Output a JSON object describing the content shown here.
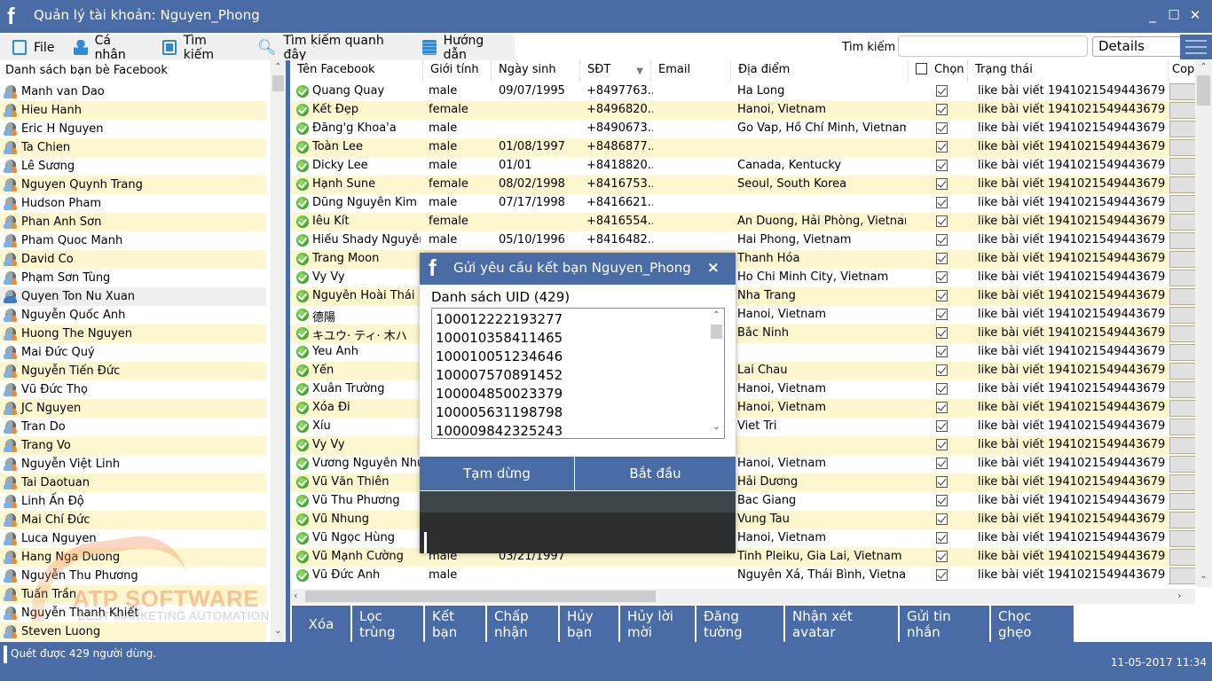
{
  "window": {
    "title": "Quản lý tài khoản: Nguyen_Phong",
    "logo": "f",
    "controls": {
      "minimize": "_",
      "maximize": "☐",
      "close": "✕"
    }
  },
  "menu": {
    "items": [
      {
        "label": "File",
        "icon": "file-icon"
      },
      {
        "label": "Cá nhân",
        "icon": "person-icon"
      },
      {
        "label": "Tìm kiếm",
        "icon": "id-card-icon"
      },
      {
        "label": "Tìm kiếm quanh đây",
        "icon": "search-icon"
      },
      {
        "label": "Hướng dẫn",
        "icon": "book-icon"
      }
    ],
    "search_label": "Tìm kiếm",
    "search_value": "",
    "view_selected": "Details"
  },
  "friends": {
    "header": "Danh sách bạn bè Facebook",
    "selected_index": 11,
    "items": [
      "Manh van Dao",
      "Hieu Hanh",
      "Eric H Nguyen",
      "Ta Chien",
      "Lê Sương",
      "Nguyen Quynh Trang",
      "Hudson Pham",
      "Phan Anh Sơn",
      "Pham Quoc Manh",
      "David Co",
      "Phạm Sơn Tùng",
      "Quyen Ton Nu Xuan",
      "Nguyễn Quốc Anh",
      "Huong The Nguyen",
      "Mai Đức Quý",
      "Nguyễn Tiến Đức",
      "Vũ Đức Thọ",
      "JC Nguyen",
      "Tran Do",
      "Trang Vo",
      "Nguyễn Việt Linh",
      "Tai Daotuan",
      "Linh Ấn Độ",
      "Mai Chí Đức",
      "Luca Nguyen",
      "Hang Nga Duong",
      "Nguyễn Thu Phương",
      "Tuấn Trần",
      "Nguyễn Thanh Khiết",
      "Steven Luong"
    ]
  },
  "grid": {
    "columns": [
      "Tên Facebook",
      "Giới tính",
      "Ngày sinh",
      "SĐT",
      "Email",
      "Địa điểm",
      "Chọn",
      "Trạng thái",
      "Cop"
    ],
    "sort_column": "SĐT",
    "rows": [
      {
        "name": "Quang Quay",
        "gender": "male",
        "dob": "09/07/1995",
        "phone": "+8497763...",
        "email": "",
        "location": "Ha Long",
        "checked": true,
        "status": "like bài viết 1941021549443679"
      },
      {
        "name": "Kết Đẹp",
        "gender": "female",
        "dob": "",
        "phone": "+8496820...",
        "email": "",
        "location": "Hanoi, Vietnam",
        "checked": true,
        "status": "like bài viết 1941021549443679"
      },
      {
        "name": "Đăng'g Khoa'a",
        "gender": "male",
        "dob": "",
        "phone": "+8490673...",
        "email": "",
        "location": "Go Vap, Hồ Chí Minh, Vietnam",
        "checked": true,
        "status": "like bài viết 1941021549443679"
      },
      {
        "name": "Toàn Lee",
        "gender": "male",
        "dob": "01/08/1997",
        "phone": "+8486877...",
        "email": "",
        "location": "",
        "checked": true,
        "status": "like bài viết 1941021549443679"
      },
      {
        "name": "Dicky Lee",
        "gender": "male",
        "dob": "01/01",
        "phone": "+8418820...",
        "email": "",
        "location": "Canada, Kentucky",
        "checked": true,
        "status": "like bài viết 1941021549443679"
      },
      {
        "name": "Hạnh Sune",
        "gender": "female",
        "dob": "08/02/1998",
        "phone": "+8416753...",
        "email": "",
        "location": "Seoul, South Korea",
        "checked": true,
        "status": "like bài viết 1941021549443679"
      },
      {
        "name": "Dũng Nguyễn Kim",
        "gender": "male",
        "dob": "07/17/1998",
        "phone": "+8416621...",
        "email": "",
        "location": "",
        "checked": true,
        "status": "like bài viết 1941021549443679"
      },
      {
        "name": "Iêu Kít",
        "gender": "female",
        "dob": "",
        "phone": "+8416554...",
        "email": "",
        "location": "An Duong, Hải Phòng, Vietnam",
        "checked": true,
        "status": "like bài viết 1941021549443679"
      },
      {
        "name": "Hiếu Shady Nguyễn",
        "gender": "male",
        "dob": "05/10/1996",
        "phone": "+8416482...",
        "email": "",
        "location": "Hai Phong, Vietnam",
        "checked": true,
        "status": "like bài viết 1941021549443679"
      },
      {
        "name": "Trang Moon",
        "gender": "",
        "dob": "",
        "phone": "",
        "email": "",
        "location": "Thanh Hóa",
        "checked": true,
        "status": "like bài viết 1941021549443679"
      },
      {
        "name": "Vy Vy",
        "gender": "",
        "dob": "",
        "phone": "",
        "email": "",
        "location": "Ho Chi Minh City, Vietnam",
        "checked": true,
        "status": "like bài viết 1941021549443679"
      },
      {
        "name": "Nguyễn Hoài Thái",
        "gender": "",
        "dob": "",
        "phone": "",
        "email": "",
        "location": "Nha Trang",
        "checked": true,
        "status": "like bài viết 1941021549443679"
      },
      {
        "name": "德陽",
        "gender": "",
        "dob": "",
        "phone": "",
        "email": "",
        "location": "Hanoi, Vietnam",
        "checked": true,
        "status": "like bài viết 1941021549443679"
      },
      {
        "name": "キユウ· ティ· 木ハ",
        "gender": "",
        "dob": "",
        "phone": "",
        "email": "",
        "location": "Bắc Ninh",
        "checked": true,
        "status": "like bài viết 1941021549443679"
      },
      {
        "name": "Yeu Anh",
        "gender": "",
        "dob": "",
        "phone": "",
        "email": "",
        "location": "",
        "checked": true,
        "status": "like bài viết 1941021549443679"
      },
      {
        "name": "Yến",
        "gender": "",
        "dob": "",
        "phone": "",
        "email": "",
        "location": "Lai Chau",
        "checked": true,
        "status": "like bài viết 1941021549443679"
      },
      {
        "name": "Xuân Trường",
        "gender": "",
        "dob": "",
        "phone": "",
        "email": "",
        "location": "Hanoi, Vietnam",
        "checked": true,
        "status": "like bài viết 1941021549443679"
      },
      {
        "name": "Xóa Đi",
        "gender": "",
        "dob": "",
        "phone": "",
        "email": "",
        "location": "Hanoi, Vietnam",
        "checked": true,
        "status": "like bài viết 1941021549443679"
      },
      {
        "name": "Xíu",
        "gender": "",
        "dob": "",
        "phone": "",
        "email": "",
        "location": "Viet Tri",
        "checked": true,
        "status": "like bài viết 1941021549443679"
      },
      {
        "name": "Vy Vy",
        "gender": "",
        "dob": "",
        "phone": "",
        "email": "",
        "location": "",
        "checked": true,
        "status": "like bài viết 1941021549443679"
      },
      {
        "name": "Vương Nguyễn Như",
        "gender": "",
        "dob": "",
        "phone": "",
        "email": "",
        "location": "Hanoi, Vietnam",
        "checked": true,
        "status": "like bài viết 1941021549443679"
      },
      {
        "name": "Vũ Văn Thiên",
        "gender": "",
        "dob": "",
        "phone": "",
        "email": "",
        "location": "Hải Dương",
        "checked": true,
        "status": "like bài viết 1941021549443679"
      },
      {
        "name": "Vũ Thu Phương",
        "gender": "",
        "dob": "",
        "phone": "",
        "email": "",
        "location": "Bac Giang",
        "checked": true,
        "status": "like bài viết 1941021549443679"
      },
      {
        "name": "Vũ Nhung",
        "gender": "",
        "dob": "",
        "phone": "",
        "email": "",
        "location": "Vung Tau",
        "checked": true,
        "status": "like bài viết 1941021549443679"
      },
      {
        "name": "Vũ Ngọc Hùng",
        "gender": "",
        "dob": "",
        "phone": "",
        "email": "",
        "location": "Hanoi, Vietnam",
        "checked": true,
        "status": "like bài viết 1941021549443679"
      },
      {
        "name": "Vũ Mạnh Cường",
        "gender": "male",
        "dob": "03/21/1997",
        "phone": "",
        "email": "",
        "location": "Tinh Pleiku, Gia Lai, Vietnam",
        "checked": true,
        "status": "like bài viết 1941021549443679"
      },
      {
        "name": "Vũ Đức Anh",
        "gender": "male",
        "dob": "",
        "phone": "",
        "email": "",
        "location": "Nguyên Xá, Thái Bình, Vietnam",
        "checked": true,
        "status": "like bài viết 1941021549443679"
      }
    ]
  },
  "actions": [
    "Xóa",
    "Lọc trùng",
    "Kết bạn",
    "Chấp nhận",
    "Hủy bạn",
    "Hủy lời mời",
    "Đăng tường",
    "Nhận xét avatar",
    "Gửi tin nhắn",
    "Chọc ghẹo"
  ],
  "dialog": {
    "title": "Gửi yêu cầu kết bạn Nguyen_Phong",
    "close": "×",
    "uid_label": "Danh sách UID (429)",
    "uids": [
      "100012222193277",
      "100010358411465",
      "100010051234646",
      "100007570891452",
      "100004850023379",
      "100005631198798",
      "100009842325243"
    ],
    "pause_label": "Tạm dừng",
    "start_label": "Bắt đầu"
  },
  "watermark": {
    "title": "ATP SOFTWARE",
    "subtitle": "BEST MARKETING AUTOMATION"
  },
  "status": {
    "text": "Quét được 429 người dùng.",
    "datetime": "11-05-2017 11:34"
  },
  "colors": {
    "brand": "#4a6ca6",
    "row_alt": "#fdf7d0",
    "dialog_log": "#2d2e30"
  }
}
